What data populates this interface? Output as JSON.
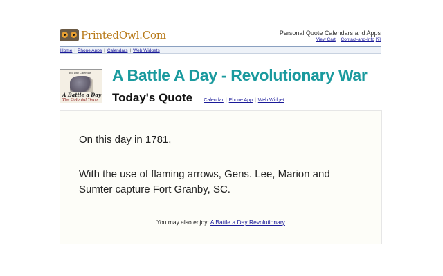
{
  "site": {
    "name": "PrintedOwl.Com",
    "tagline": "Personal Quote Calendars and Apps",
    "top_links": [
      "View Cart",
      "Contact-and-Info",
      "[?]"
    ]
  },
  "nav": {
    "items": [
      "Home",
      "Phone Apps",
      "Calendars",
      "Web Widgets"
    ]
  },
  "book": {
    "caption": "365 Day Calendar",
    "title_line": "A Battle a Day",
    "subtitle_line": "The Colonial Years"
  },
  "page": {
    "title": "A Battle A Day - Revolutionary War",
    "subtitle": "Today's Quote",
    "sub_links": [
      "Calendar",
      "Phone App",
      "Web Widget"
    ]
  },
  "quote": {
    "intro": "On this day in 1781,",
    "text": "With the use of flaming arrows, Gens. Lee, Marion and Sumter capture Fort Granby, SC."
  },
  "enjoy": {
    "prefix": "You may also enjoy:",
    "link": "A Battle a Day Revolutionary"
  },
  "colors": {
    "title": "#1a9a9e",
    "brand": "#b87a1a",
    "link": "#1a1a99"
  }
}
